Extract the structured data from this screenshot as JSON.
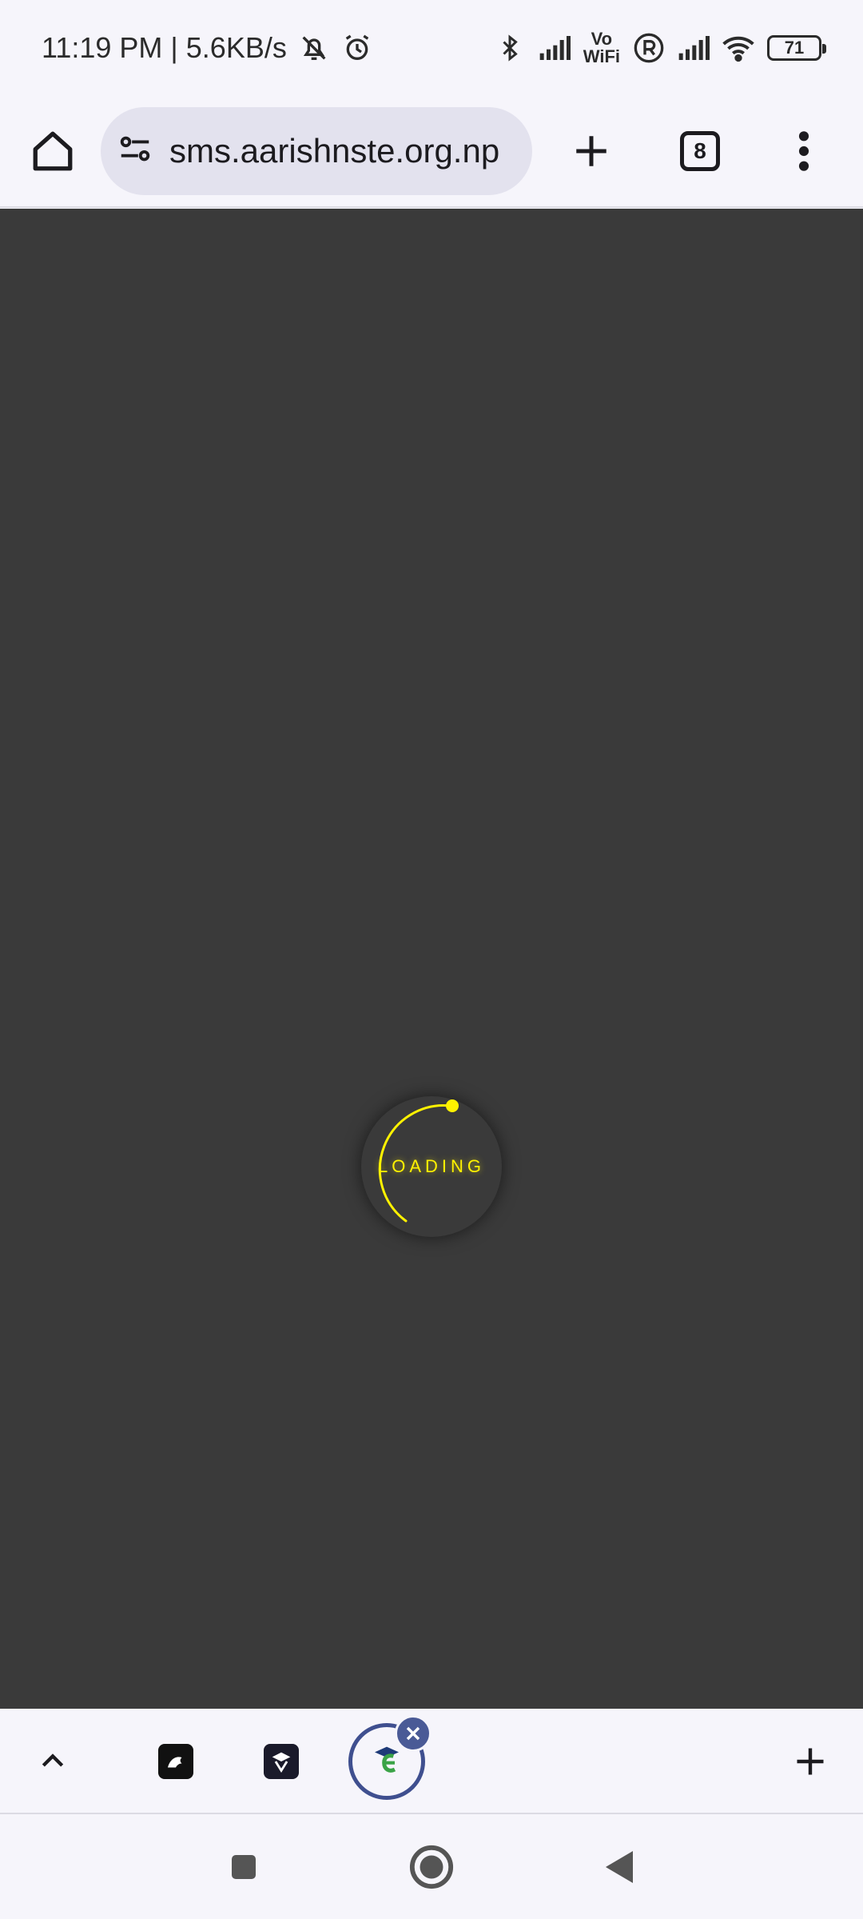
{
  "status_bar": {
    "time_speed": "11:19 PM | 5.6KB/s",
    "vowifi_top": "Vo",
    "vowifi_bottom": "WiFi",
    "battery_level": "71",
    "icons": [
      "mute-bell-icon",
      "alarm-icon",
      "bluetooth-icon",
      "signal-icon",
      "vowifi-icon",
      "roaming-icon",
      "signal-icon",
      "wifi-icon",
      "battery-icon"
    ]
  },
  "toolbar": {
    "url": "sms.aarishnste.org.np",
    "tab_count": "8",
    "icons": [
      "home-icon",
      "site-settings-icon",
      "new-tab-icon",
      "tab-switcher-icon",
      "more-vert-icon"
    ]
  },
  "content": {
    "background": "#3a3a3a",
    "accent": "#fff200",
    "loading_text": "LOADING"
  },
  "tab_strip": {
    "icons": [
      "chevron-up-icon",
      "tab-favicon",
      "tab-favicon",
      "graduation-favicon",
      "close-icon",
      "add-icon"
    ],
    "active_tab_color": "#3f4f8f"
  },
  "nav_bar": {
    "icons": [
      "recents-icon",
      "home-icon",
      "back-icon"
    ]
  }
}
